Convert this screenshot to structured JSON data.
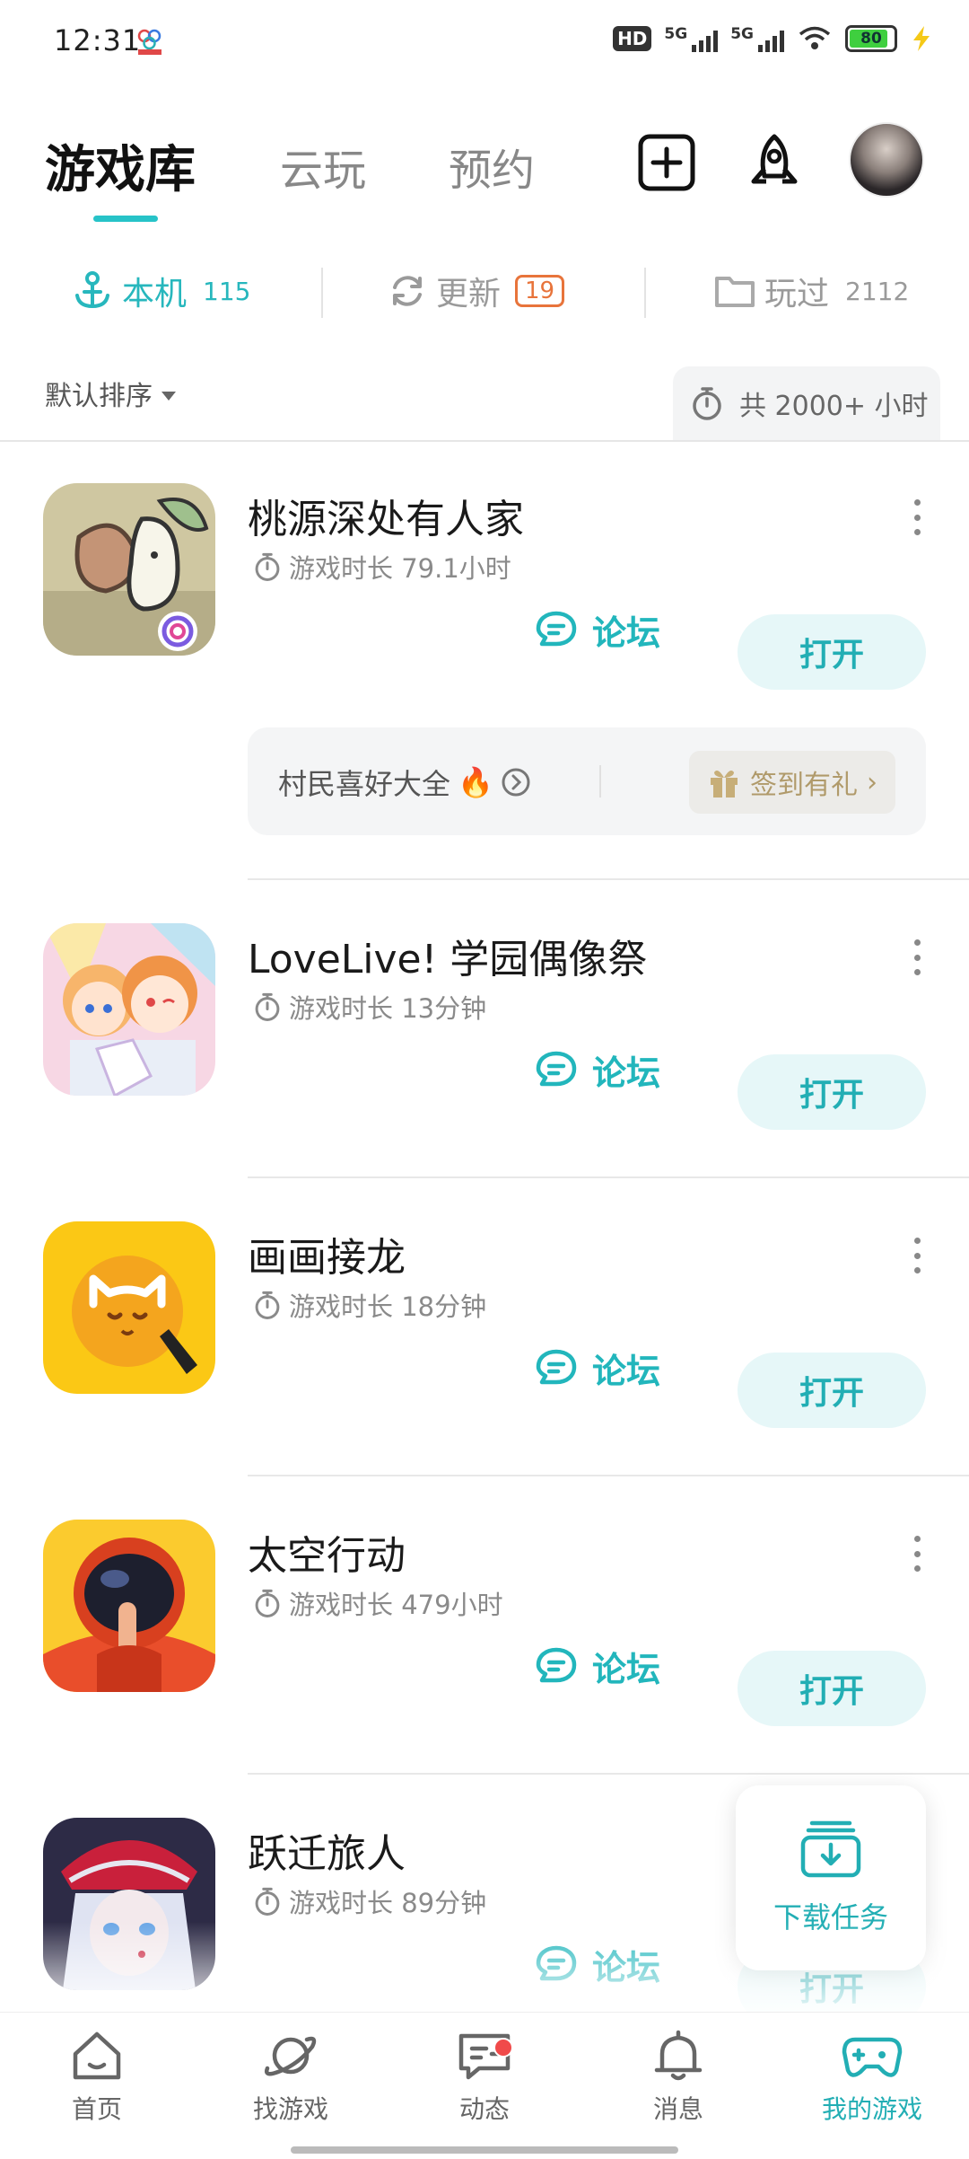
{
  "status_bar": {
    "time": "12:31",
    "hd_label": "HD",
    "sim1_label": "5G",
    "sim2_label": "5G",
    "battery": "80"
  },
  "top_tabs": [
    {
      "label": "游戏库",
      "active": true
    },
    {
      "label": "云玩",
      "active": false
    },
    {
      "label": "预约",
      "active": false
    }
  ],
  "sub_tabs": {
    "local": {
      "label": "本机",
      "count": "115"
    },
    "updates": {
      "label": "更新",
      "count": "19"
    },
    "played": {
      "label": "玩过",
      "count": "2112"
    }
  },
  "sort": {
    "label": "默认排序"
  },
  "total_time": "共 2000+ 小时",
  "games": [
    {
      "title": "桃源深处有人家",
      "playtime": "游戏时长 79.1小时",
      "forum_label": "论坛",
      "open_label": "打开"
    },
    {
      "title": "LoveLive! 学园偶像祭",
      "playtime": "游戏时长 13分钟",
      "forum_label": "论坛",
      "open_label": "打开"
    },
    {
      "title": "画画接龙",
      "playtime": "游戏时长 18分钟",
      "forum_label": "论坛",
      "open_label": "打开"
    },
    {
      "title": "太空行动",
      "playtime": "游戏时长 479小时",
      "forum_label": "论坛",
      "open_label": "打开"
    },
    {
      "title": "跃迁旅人",
      "playtime": "游戏时长 89分钟",
      "forum_label": "论坛",
      "open_label": "打开"
    }
  ],
  "promo": {
    "text": "村民喜好大全",
    "gift_label": "签到有礼"
  },
  "download_task": {
    "label": "下载任务"
  },
  "bottom_nav": [
    {
      "label": "首页",
      "icon": "home-icon"
    },
    {
      "label": "找游戏",
      "icon": "planet-icon"
    },
    {
      "label": "动态",
      "icon": "chat-icon"
    },
    {
      "label": "消息",
      "icon": "bell-icon"
    },
    {
      "label": "我的游戏",
      "icon": "gamepad-icon"
    }
  ],
  "colors": {
    "accent": "#22aeb4",
    "badge_orange": "#e8743b",
    "notify_red": "#f04a4a"
  }
}
